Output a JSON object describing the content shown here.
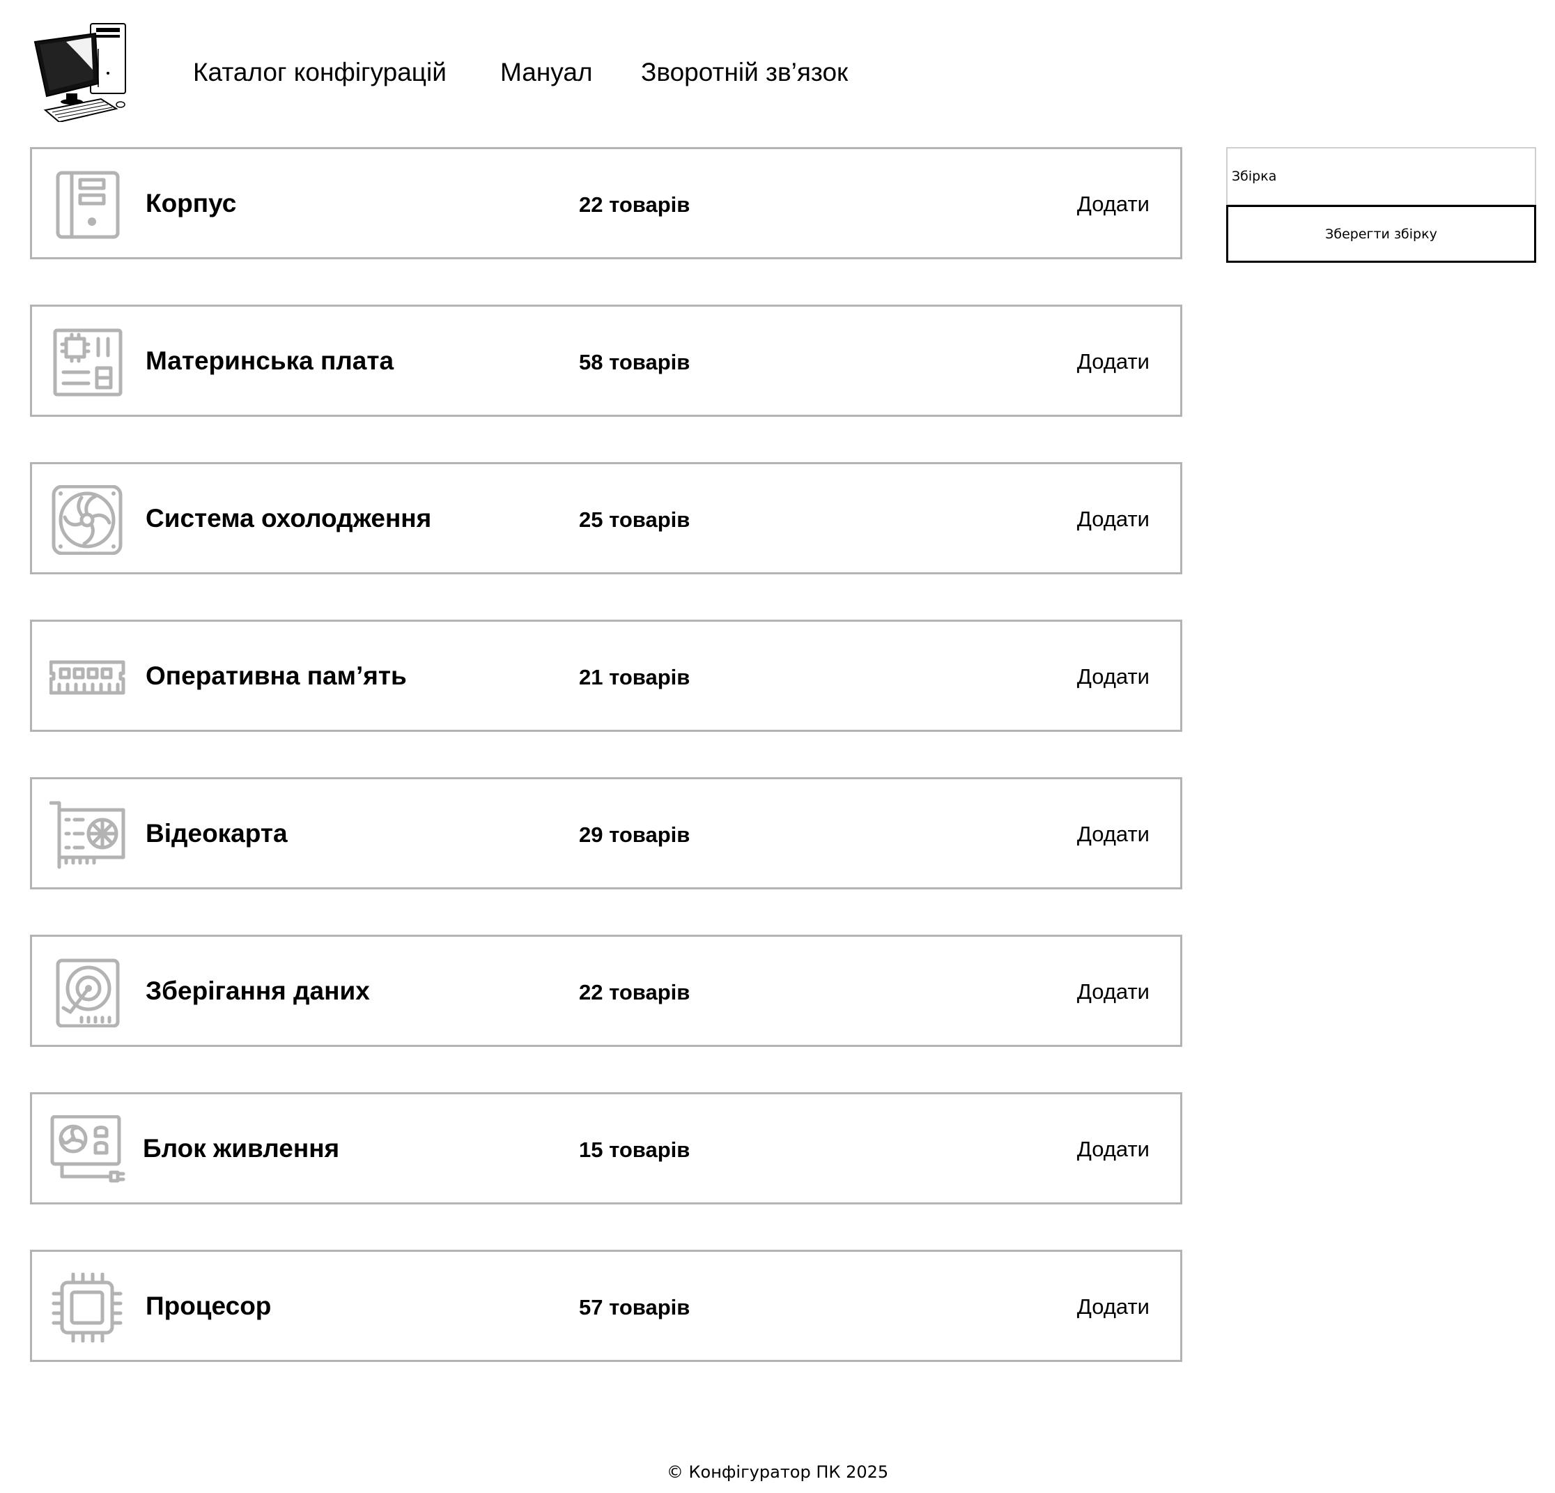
{
  "header": {
    "logo_icon": "desktop-computer-logo",
    "nav": [
      {
        "label": "Каталог конфігурацій"
      },
      {
        "label": "Мануал"
      },
      {
        "label": "Зворотній зв’язок"
      }
    ]
  },
  "categories": [
    {
      "icon": "pc-case-icon",
      "title": "Корпус",
      "count": "22 товарів",
      "add_label": "Додати"
    },
    {
      "icon": "motherboard-icon",
      "title": "Материнська плата",
      "count": "58 товарів",
      "add_label": "Додати"
    },
    {
      "icon": "cooling-fan-icon",
      "title": "Система охолодження",
      "count": "25 товарів",
      "add_label": "Додати"
    },
    {
      "icon": "ram-icon",
      "title": "Оперативна пам’ять",
      "count": "21 товарів",
      "add_label": "Додати"
    },
    {
      "icon": "gpu-icon",
      "title": "Відеокарта",
      "count": "29 товарів",
      "add_label": "Додати"
    },
    {
      "icon": "hard-drive-icon",
      "title": "Зберігання даних",
      "count": "22 товарів",
      "add_label": "Додати"
    },
    {
      "icon": "power-supply-icon",
      "title": "Блок живлення",
      "count": "15 товарів",
      "add_label": "Додати"
    },
    {
      "icon": "cpu-icon",
      "title": "Процесор",
      "count": "57 товарів",
      "add_label": "Додати"
    }
  ],
  "build": {
    "placeholder": "Збірка",
    "save_label": "Зберегти збірку"
  },
  "footer": {
    "text": "© Конфігуратор ПК 2025"
  },
  "colors": {
    "border": "#b3b3b3",
    "icon": "#b3b3b3",
    "text": "#000000",
    "background": "#ffffff"
  }
}
